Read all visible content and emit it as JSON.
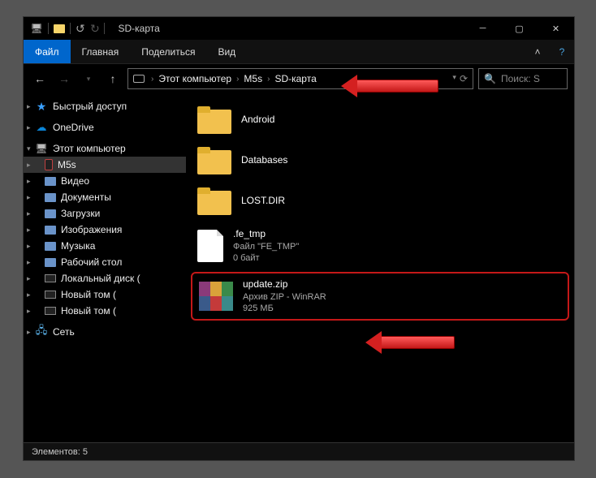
{
  "title": "SD-карта",
  "ribbon": {
    "file": "Файл",
    "home": "Главная",
    "share": "Поделиться",
    "view": "Вид"
  },
  "breadcrumb": {
    "pc": "Этот компьютер",
    "dev": "M5s",
    "loc": "SD-карта"
  },
  "search": {
    "placeholder": "Поиск: S"
  },
  "nav": {
    "quick": "Быстрый доступ",
    "onedrive": "OneDrive",
    "thispc": "Этот компьютер",
    "m5s": "M5s",
    "video": "Видео",
    "documents": "Документы",
    "downloads": "Загрузки",
    "pictures": "Изображения",
    "music": "Музыка",
    "desktop": "Рабочий стол",
    "drive_c": "Локальный диск (",
    "drive_n1": "Новый том (",
    "drive_n2": "Новый том (",
    "network": "Сеть"
  },
  "files": {
    "android": {
      "name": "Android"
    },
    "databases": {
      "name": "Databases"
    },
    "lostdir": {
      "name": "LOST.DIR"
    },
    "fetmp": {
      "name": ".fe_tmp",
      "type": "Файл \"FE_TMP\"",
      "size": "0 байт"
    },
    "update": {
      "name": "update.zip",
      "type": "Архив ZIP - WinRAR",
      "size": "925 МБ"
    }
  },
  "status": {
    "count_label": "Элементов:",
    "count": "5"
  }
}
